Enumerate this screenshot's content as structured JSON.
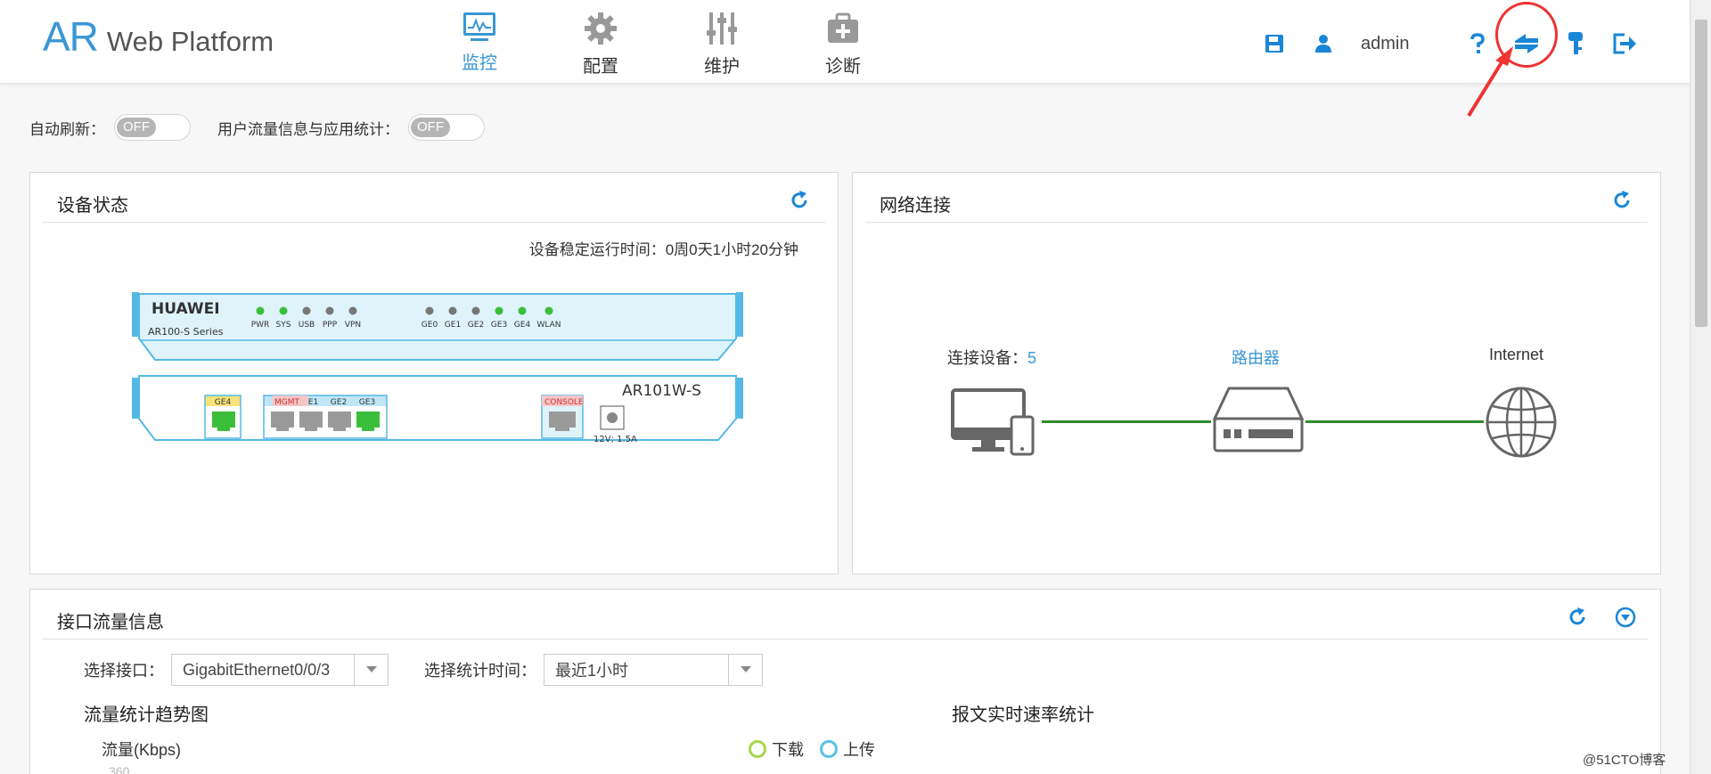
{
  "header": {
    "logo_main": "AR",
    "logo_sub": "Web Platform",
    "nav": [
      {
        "label": "监控",
        "icon": "monitor-icon",
        "active": true
      },
      {
        "label": "配置",
        "icon": "gear-icon",
        "active": false
      },
      {
        "label": "维护",
        "icon": "sliders-icon",
        "active": false
      },
      {
        "label": "诊断",
        "icon": "medical-kit-icon",
        "active": false
      }
    ],
    "username": "admin",
    "tools": [
      "save-icon",
      "user-icon",
      "help-icon",
      "switch-arrows-icon",
      "key-icon",
      "logout-icon"
    ]
  },
  "toggles": {
    "auto_refresh_label": "自动刷新：",
    "auto_refresh_state": "OFF",
    "traffic_stats_label": "用户流量信息与应用统计：",
    "traffic_stats_state": "OFF"
  },
  "device_panel": {
    "title": "设备状态",
    "uptime": "设备稳定运行时间：0周0天1小时20分钟",
    "brand": "HUAWEI",
    "series": "AR100-S Series",
    "model": "AR101W-S",
    "power_label": "12V; 1.5A",
    "leds": [
      {
        "label": "PWR",
        "on": true
      },
      {
        "label": "SYS",
        "on": true
      },
      {
        "label": "USB",
        "on": false
      },
      {
        "label": "PPP",
        "on": false
      },
      {
        "label": "VPN",
        "on": false
      },
      {
        "label": "GE0",
        "on": false
      },
      {
        "label": "GE1",
        "on": false
      },
      {
        "label": "GE2",
        "on": false
      },
      {
        "label": "GE3",
        "on": true
      },
      {
        "label": "GE4",
        "on": true
      },
      {
        "label": "WLAN",
        "on": true
      }
    ],
    "ports": [
      {
        "label": "GE4",
        "up": true
      },
      {
        "label": "GE0",
        "up": false
      },
      {
        "label": "GE1",
        "up": false
      },
      {
        "label": "GE2",
        "up": false
      },
      {
        "label": "GE3",
        "up": true
      }
    ],
    "mgmt_label": "MGMT",
    "console_label": "CONSOLE",
    "colors": {
      "led_on": "#3bbf3b",
      "led_off": "#777777",
      "port_up": "#3bbf3b",
      "port_down": "#9a9a9a"
    }
  },
  "network_panel": {
    "title": "网络连接",
    "connected_label": "连接设备：",
    "connected_count": "5",
    "router_label": "路由器",
    "internet_label": "Internet"
  },
  "traffic_panel": {
    "title": "接口流量信息",
    "interface_label": "选择接口：",
    "interface_value": "GigabitEthernet0/0/3",
    "time_label": "选择统计时间：",
    "time_value": "最近1小时",
    "trend_title": "流量统计趋势图",
    "rate_title": "报文实时速率统计",
    "y_label": "流量(Kbps)",
    "legend": [
      {
        "label": "下载",
        "color": "#a6d84a"
      },
      {
        "label": "上传",
        "color": "#58c2e8"
      }
    ],
    "tick_peek": "360"
  },
  "watermark": "@51CTO博客",
  "theme": {
    "accent": "#3a97d4",
    "annotation_red": "#e33333"
  }
}
